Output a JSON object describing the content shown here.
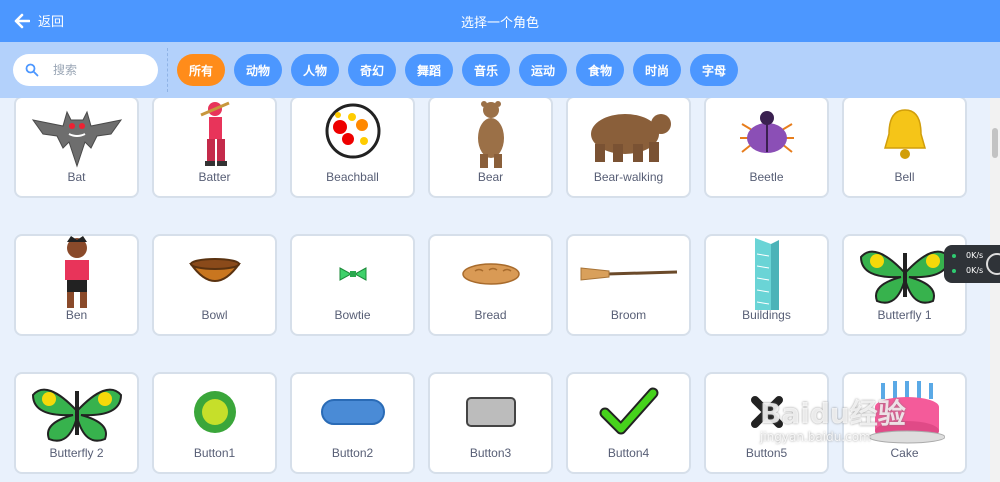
{
  "header": {
    "back_label": "返回",
    "title": "选择一个角色"
  },
  "search": {
    "placeholder": "搜索"
  },
  "categories": [
    "所有",
    "动物",
    "人物",
    "奇幻",
    "舞蹈",
    "音乐",
    "运动",
    "食物",
    "时尚",
    "字母"
  ],
  "selected_category": "所有",
  "sprites": [
    {
      "name": "Bat",
      "icon": "bat-icon"
    },
    {
      "name": "Batter",
      "icon": "batter-icon"
    },
    {
      "name": "Beachball",
      "icon": "beachball-icon"
    },
    {
      "name": "Bear",
      "icon": "bear-icon"
    },
    {
      "name": "Bear-walking",
      "icon": "bear-walking-icon"
    },
    {
      "name": "Beetle",
      "icon": "beetle-icon"
    },
    {
      "name": "Bell",
      "icon": "bell-icon"
    },
    {
      "name": "Ben",
      "icon": "ben-icon"
    },
    {
      "name": "Bowl",
      "icon": "bowl-icon"
    },
    {
      "name": "Bowtie",
      "icon": "bowtie-icon"
    },
    {
      "name": "Bread",
      "icon": "bread-icon"
    },
    {
      "name": "Broom",
      "icon": "broom-icon"
    },
    {
      "name": "Buildings",
      "icon": "buildings-icon"
    },
    {
      "name": "Butterfly 1",
      "icon": "butterfly-icon"
    },
    {
      "name": "Butterfly 2",
      "icon": "butterfly-icon"
    },
    {
      "name": "Button1",
      "icon": "button-icon"
    },
    {
      "name": "Button2",
      "icon": "button-icon"
    },
    {
      "name": "Button3",
      "icon": "button-icon"
    },
    {
      "name": "Button4",
      "icon": "checkmark-icon"
    },
    {
      "name": "Button5",
      "icon": "x-icon"
    },
    {
      "name": "Cake",
      "icon": "cake-icon"
    }
  ],
  "speed_widget": {
    "up": "0K/s",
    "down": "0K/s"
  },
  "watermark": {
    "brand": "Baidu经验",
    "url": "jingyan.baidu.com"
  },
  "colors": {
    "header": "#4c97ff",
    "filter_bar": "#b3d1fb",
    "active_tag": "#ff8c1a",
    "tag": "#4c97ff"
  }
}
